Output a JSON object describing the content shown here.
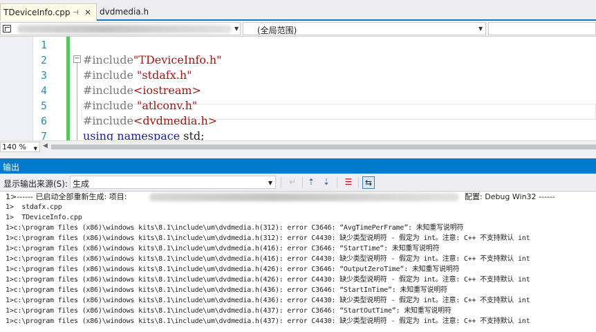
{
  "tabs": [
    {
      "label": "TDeviceInfo.cpp",
      "active": true
    },
    {
      "label": "dvdmedia.h",
      "active": false
    }
  ],
  "tab_pin_glyph": "⊣",
  "tab_close_glyph": "✕",
  "navbar": {
    "scope": "(全局范围)"
  },
  "editor": {
    "line_numbers": [
      "1",
      "2",
      "3",
      "4",
      "5",
      "6",
      "7"
    ],
    "lines": [
      {
        "pre": "",
        "kw": "",
        "str": ""
      },
      {
        "pre": "",
        "kw": "#include",
        "str": "\"TDeviceInfo.h\""
      },
      {
        "pre": "",
        "kw": "#include ",
        "str": "\"stdafx.h\""
      },
      {
        "pre": "",
        "kw": "#include",
        "str": "<iostream>"
      },
      {
        "pre": "",
        "kw": "#include ",
        "str": "\"atlconv.h\""
      },
      {
        "pre": "",
        "kw": "#include",
        "str": "<dvdmedia.h>"
      },
      {
        "pre": "",
        "kw": "using namespace",
        "str": " std;"
      }
    ],
    "fold_glyph": "−"
  },
  "zoom": {
    "value": "140 %"
  },
  "output": {
    "title": "输出",
    "source_label": "显示输出来源(S):",
    "source_value": "生成",
    "lines": [
      "1>------ 已启动全部重新生成: 项目:",
      "1>  stdafx.cpp",
      "1>  TDeviceInfo.cpp",
      "1>c:\\program files (x86)\\windows kits\\8.1\\include\\um\\dvdmedia.h(312): error C3646: “AvgTimePerFrame”: 未知重写说明符",
      "1>c:\\program files (x86)\\windows kits\\8.1\\include\\um\\dvdmedia.h(312): error C4430: 缺少类型说明符 - 假定为 int。注意: C++ 不支持默认 int",
      "1>c:\\program files (x86)\\windows kits\\8.1\\include\\um\\dvdmedia.h(416): error C3646: “StartTime”: 未知重写说明符",
      "1>c:\\program files (x86)\\windows kits\\8.1\\include\\um\\dvdmedia.h(416): error C4430: 缺少类型说明符 - 假定为 int。注意: C++ 不支持默认 int",
      "1>c:\\program files (x86)\\windows kits\\8.1\\include\\um\\dvdmedia.h(426): error C3646: “OutputZeroTime”: 未知重写说明符",
      "1>c:\\program files (x86)\\windows kits\\8.1\\include\\um\\dvdmedia.h(426): error C4430: 缺少类型说明符 - 假定为 int。注意: C++ 不支持默认 int",
      "1>c:\\program files (x86)\\windows kits\\8.1\\include\\um\\dvdmedia.h(436): error C3646: “StartInTime”: 未知重写说明符",
      "1>c:\\program files (x86)\\windows kits\\8.1\\include\\um\\dvdmedia.h(436): error C4430: 缺少类型说明符 - 假定为 int。注意: C++ 不支持默认 int",
      "1>c:\\program files (x86)\\windows kits\\8.1\\include\\um\\dvdmedia.h(437): error C3646: “StartOutTime”: 未知重写说明符",
      "1>c:\\program files (x86)\\windows kits\\8.1\\include\\um\\dvdmedia.h(437): error C4430: 缺少类型说明符 - 假定为 int。注意: C++ 不支持默认 int"
    ],
    "config_text": "配置: Debug Win32 ------"
  },
  "colors": {
    "accent": "#007acc",
    "change_bar": "#57c557",
    "string": "#a31515",
    "line_number": "#2b91af"
  }
}
